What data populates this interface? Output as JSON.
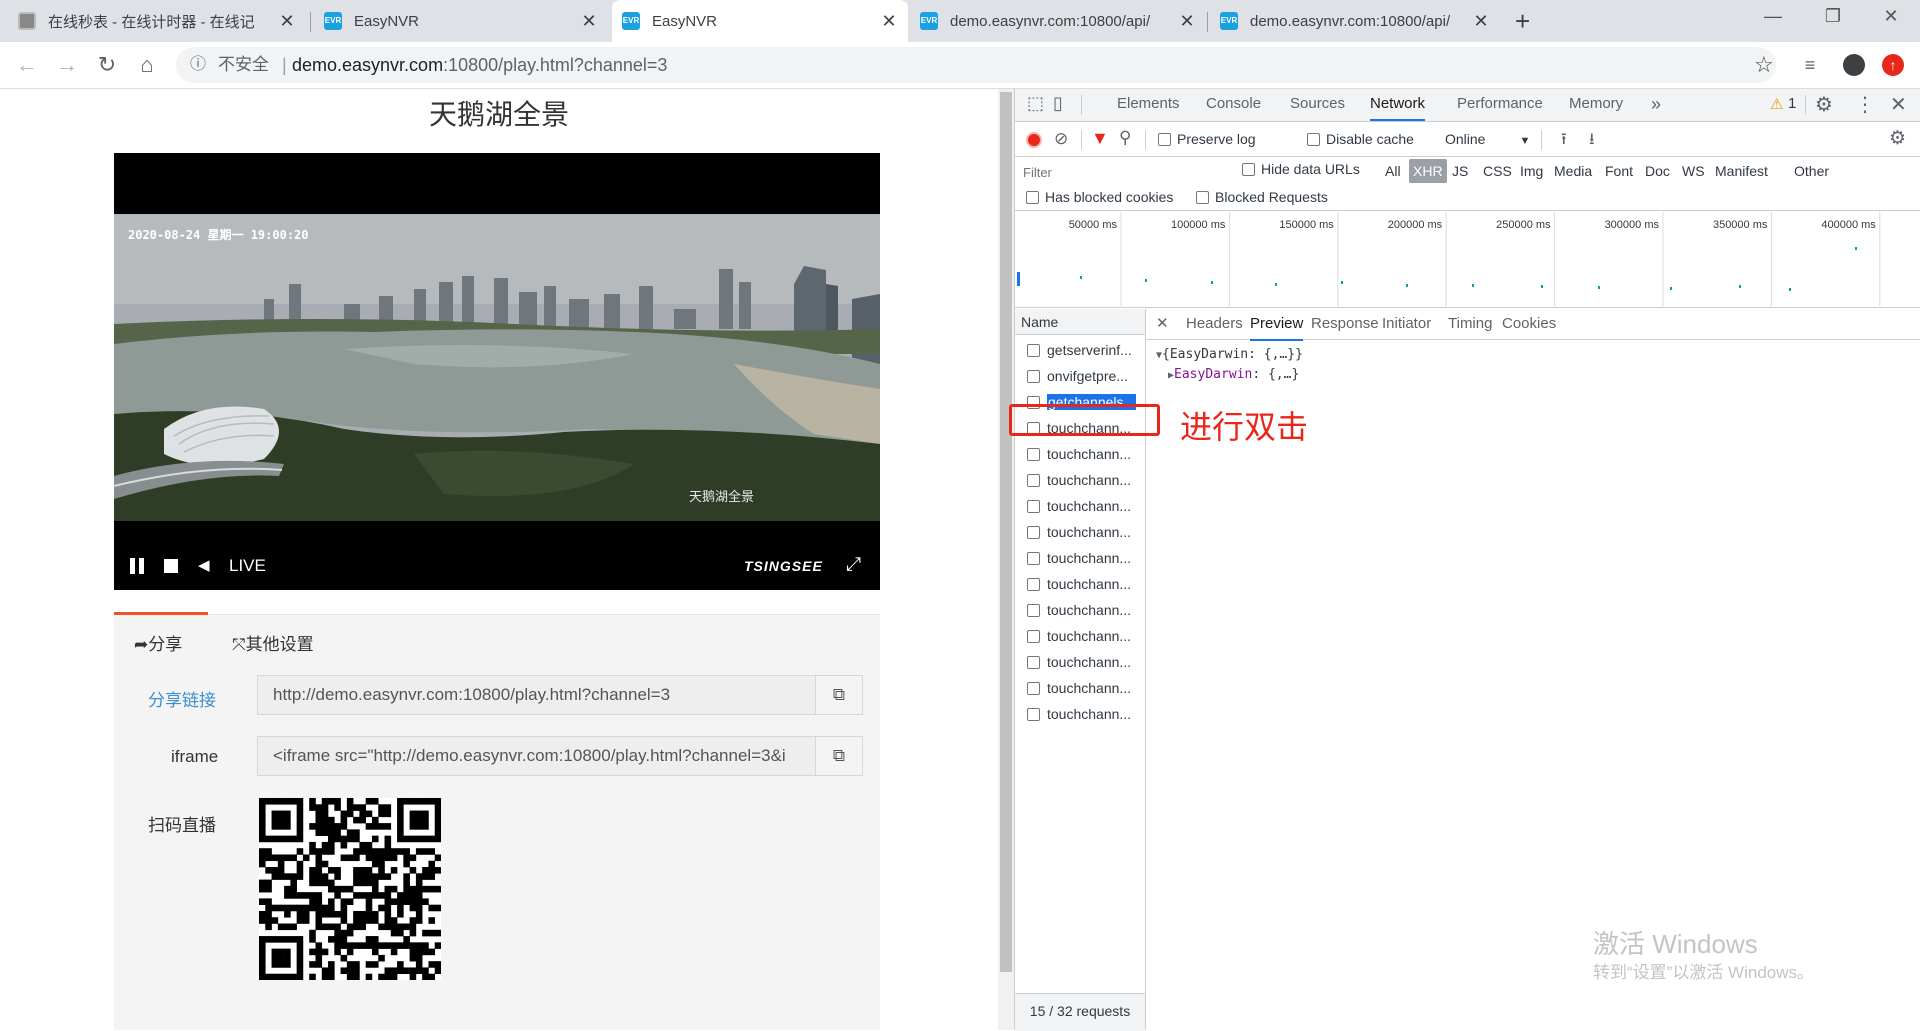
{
  "browser": {
    "tabs": [
      {
        "title": "在线秒表 - 在线计时器 - 在线记",
        "favicon": "gray"
      },
      {
        "title": "EasyNVR",
        "favicon": "nvr"
      },
      {
        "title": "EasyNVR",
        "favicon": "nvr"
      },
      {
        "title": "demo.easynvr.com:10800/api/",
        "favicon": "nvr"
      },
      {
        "title": "demo.easynvr.com:10800/api/",
        "favicon": "nvr"
      }
    ],
    "favicon_text": "EVR",
    "security_label": "不安全",
    "url_host": "demo.easynvr.com",
    "url_rest": ":10800/play.html?channel=3"
  },
  "page": {
    "title": "天鹅湖全景",
    "video": {
      "timestamp": "2020-08-24  星期一  19:00:20",
      "watermark": "天鹅湖全景",
      "live_label": "LIVE",
      "brand": "TSINGSEE"
    },
    "share": {
      "tab_share": "分享",
      "tab_other": "其他设置",
      "share_link_label": "分享链接",
      "share_link_value": "http://demo.easynvr.com:10800/play.html?channel=3",
      "iframe_label": "iframe",
      "iframe_value": "<iframe src=\"http://demo.easynvr.com:10800/play.html?channel=3&i",
      "qr_label": "扫码直播"
    }
  },
  "devtools": {
    "tabs": [
      "Elements",
      "Console",
      "Sources",
      "Network",
      "Performance",
      "Memory"
    ],
    "active_tab": "Network",
    "more": "»",
    "warning_count": "1",
    "toolbar": {
      "preserve_log": "Preserve log",
      "disable_cache": "Disable cache",
      "throttle": "Online"
    },
    "filter": {
      "placeholder": "Filter",
      "hide_data_urls": "Hide data URLs",
      "types": [
        "All",
        "XHR",
        "JS",
        "CSS",
        "Img",
        "Media",
        "Font",
        "Doc",
        "WS",
        "Manifest",
        "Other"
      ],
      "active_type": "XHR",
      "has_blocked_cookies": "Has blocked cookies",
      "blocked_requests": "Blocked Requests"
    },
    "timeline_ticks": [
      "50000 ms",
      "100000 ms",
      "150000 ms",
      "200000 ms",
      "250000 ms",
      "300000 ms",
      "350000 ms",
      "400000 ms"
    ],
    "name_header": "Name",
    "requests": [
      "getserverinf...",
      "onvifgetpre...",
      "getchannels...",
      "touchchann...",
      "touchchann...",
      "touchchann...",
      "touchchann...",
      "touchchann...",
      "touchchann...",
      "touchchann...",
      "touchchann...",
      "touchchann...",
      "touchchann...",
      "touchchann...",
      "touchchann..."
    ],
    "selected_request_index": 2,
    "detail_tabs": [
      "Headers",
      "Preview",
      "Response",
      "Initiator",
      "Timing",
      "Cookies"
    ],
    "active_detail_tab": "Preview",
    "preview_line1": "{EasyDarwin: {,…}}",
    "preview_key": "EasyDarwin",
    "preview_line2_rest": ": {,…}",
    "summary": "15 / 32 requests"
  },
  "annotation": {
    "text": "进行双击",
    "color": "#e8271b"
  },
  "watermark": {
    "line1": "激活 Windows",
    "line2": "转到“设置”以激活 Windows。"
  },
  "colors": {
    "accent_blue": "#1a73e8",
    "share_tab_accent": "#f0522c",
    "share_link_label": "#3a8fd0",
    "preview_key": "#881391"
  }
}
